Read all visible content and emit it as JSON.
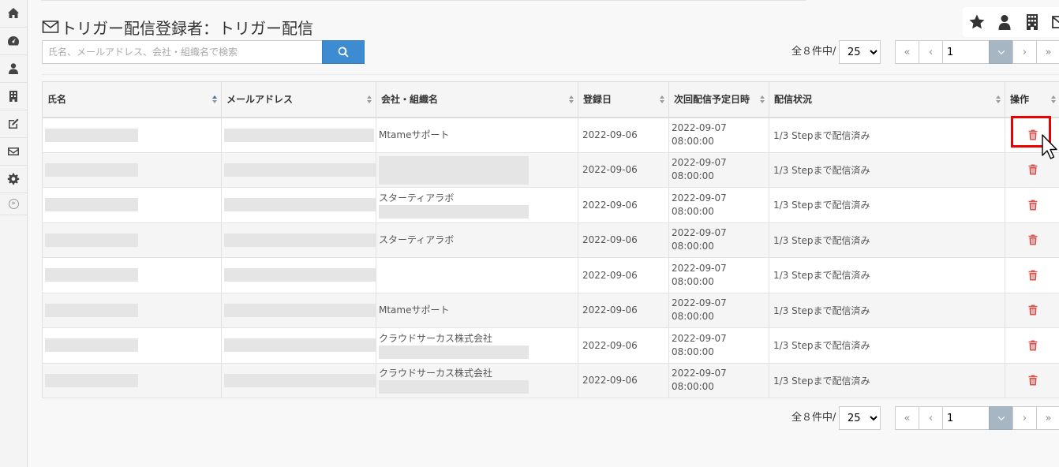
{
  "page": {
    "title": "トリガー配信登録者：トリガー配信"
  },
  "search": {
    "placeholder": "氏名、メールアドレス、会社・組織名で検索"
  },
  "pagination": {
    "count_text": "全８件中/",
    "per_page": "25",
    "current_page": "1",
    "first": "«",
    "prev": "‹",
    "next": "›",
    "last": "»"
  },
  "table": {
    "headers": [
      "氏名",
      "メールアドレス",
      "会社・組織名",
      "登録日",
      "次回配信予定日時",
      "配信状況",
      "操作"
    ],
    "rows": [
      {
        "company": "Mtameサポート",
        "company_redacted": false,
        "date": "2022-09-06",
        "next_date": "2022-09-07",
        "next_time": "08:00:00",
        "status": "1/3 Stepまで配信済み"
      },
      {
        "company": "",
        "company_redacted": true,
        "date": "2022-09-06",
        "next_date": "2022-09-07",
        "next_time": "08:00:00",
        "status": "1/3 Stepまで配信済み"
      },
      {
        "company": "スターティアラボ",
        "company_redacted": true,
        "date": "2022-09-06",
        "next_date": "2022-09-07",
        "next_time": "08:00:00",
        "status": "1/3 Stepまで配信済み"
      },
      {
        "company": "スターティアラボ",
        "company_redacted": false,
        "date": "2022-09-06",
        "next_date": "2022-09-07",
        "next_time": "08:00:00",
        "status": "1/3 Stepまで配信済み"
      },
      {
        "company": "",
        "company_redacted": false,
        "date": "2022-09-06",
        "next_date": "2022-09-07",
        "next_time": "08:00:00",
        "status": "1/3 Stepまで配信済み"
      },
      {
        "company": "Mtameサポート",
        "company_redacted": false,
        "date": "2022-09-06",
        "next_date": "2022-09-07",
        "next_time": "08:00:00",
        "status": "1/3 Stepまで配信済み"
      },
      {
        "company": "クラウドサーカス株式会社",
        "company_redacted": true,
        "date": "2022-09-06",
        "next_date": "2022-09-07",
        "next_time": "08:00:00",
        "status": "1/3 Stepまで配信済み"
      },
      {
        "company": "クラウドサーカス株式会社",
        "company_redacted": true,
        "date": "2022-09-06",
        "next_date": "2022-09-07",
        "next_time": "08:00:00",
        "status": "1/3 Stepまで配信済み"
      }
    ]
  },
  "colors": {
    "accent": "#3d8bd0",
    "delete": "#d9534f",
    "highlight": "#e00000"
  }
}
